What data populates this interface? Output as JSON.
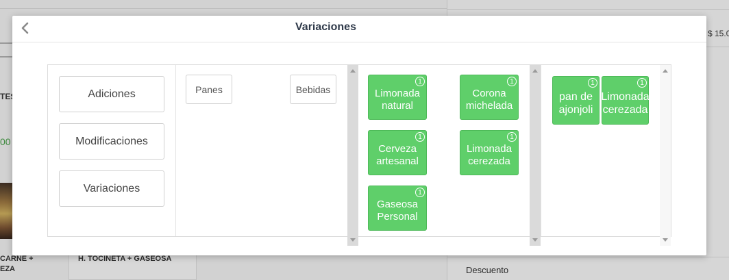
{
  "background": {
    "price_text": "$ 15.0",
    "descuento_label": "Descuento",
    "card_left_label_1": "CARNE +",
    "card_left_label_2": "EZA",
    "card_label": "H. TOCINETA + GASEOSA",
    "side_text_tes": "TES",
    "side_text_00": "00"
  },
  "modal": {
    "title": "Variaciones",
    "side_buttons": [
      {
        "label": "Adiciones"
      },
      {
        "label": "Modificaciones"
      },
      {
        "label": "Variaciones"
      }
    ],
    "categories": [
      {
        "label": "Panes"
      },
      {
        "label": "Bebidas"
      }
    ],
    "options": [
      {
        "label": "Limonada natural",
        "badge": "1"
      },
      {
        "label": "Corona michelada",
        "badge": "1"
      },
      {
        "label": "Cerveza artesanal",
        "badge": "1"
      },
      {
        "label": "Limonada cerezada",
        "badge": "1"
      },
      {
        "label": "Gaseosa Personal",
        "badge": "1"
      }
    ],
    "selected": [
      {
        "label": "pan de ajonjoli",
        "badge": "1"
      },
      {
        "label": "Limonada cerezada",
        "badge": "1"
      }
    ]
  },
  "colors": {
    "tile_green": "#5fcf6a",
    "title_color": "#2f3a4a"
  }
}
